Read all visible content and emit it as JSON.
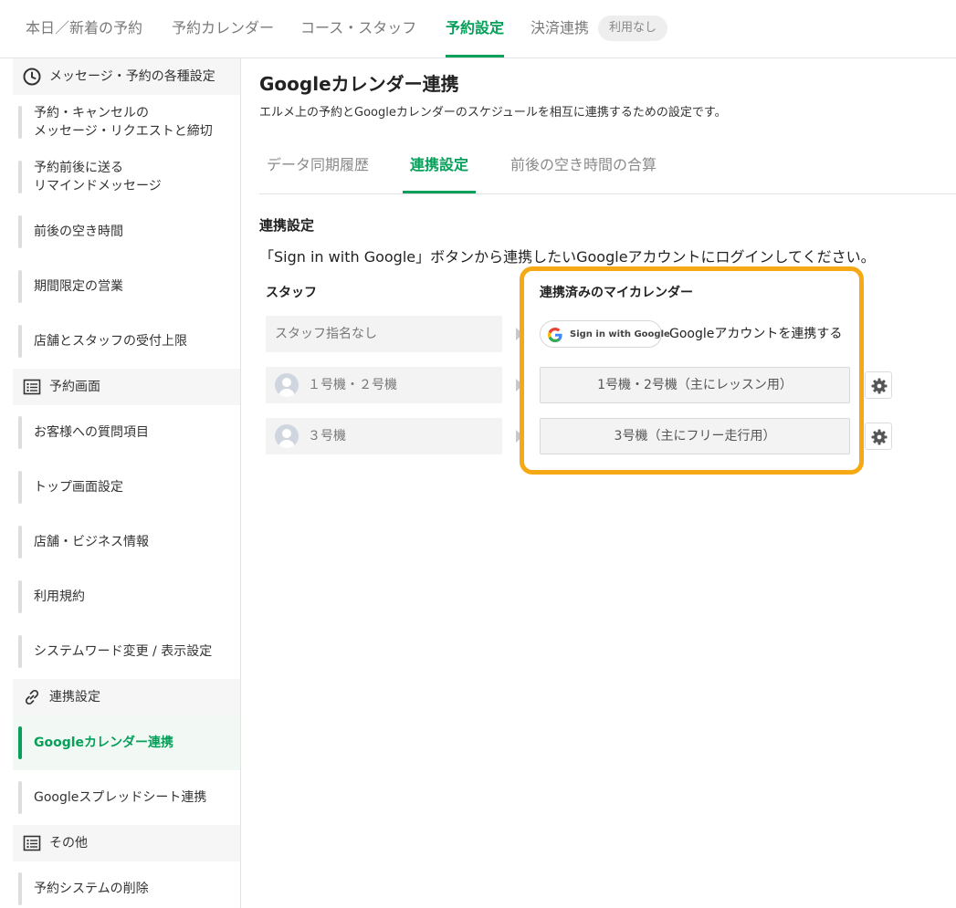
{
  "top_nav": {
    "tabs": [
      {
        "label": "本日／新着の予約"
      },
      {
        "label": "予約カレンダー"
      },
      {
        "label": "コース・スタッフ"
      },
      {
        "label": "予約設定"
      },
      {
        "label": "決済連携"
      }
    ],
    "active_tab": "予約設定",
    "payment_badge": "利用なし"
  },
  "sidebar": {
    "sections": [
      {
        "label": "メッセージ・予約の各種設定",
        "icon": "clock-icon"
      },
      {
        "label": "予約画面",
        "icon": "list-icon"
      },
      {
        "label": "連携設定",
        "icon": "link-icon"
      },
      {
        "label": "その他",
        "icon": "list-icon"
      }
    ],
    "items": [
      {
        "label": "予約・キャンセルの\nメッセージ・リクエストと締切"
      },
      {
        "label": "予約前後に送る\nリマインドメッセージ"
      },
      {
        "label": "前後の空き時間"
      },
      {
        "label": "期間限定の営業"
      },
      {
        "label": "店舗とスタッフの受付上限"
      },
      {
        "label": "お客様への質問項目"
      },
      {
        "label": "トップ画面設定"
      },
      {
        "label": "店舗・ビジネス情報"
      },
      {
        "label": "利用規約"
      },
      {
        "label": "システムワード変更 / 表示設定"
      },
      {
        "label": "Googleカレンダー連携"
      },
      {
        "label": "Googleスプレッドシート連携"
      },
      {
        "label": "予約システムの削除"
      }
    ],
    "active_item": "Googleカレンダー連携"
  },
  "main": {
    "title": "Googleカレンダー連携",
    "description": "エルメ上の予約とGoogleカレンダーのスケジュールを相互に連携するための設定です。",
    "subtabs": [
      {
        "label": "データ同期履歴"
      },
      {
        "label": "連携設定"
      },
      {
        "label": "前後の空き時間の合算"
      }
    ],
    "active_subtab": "連携設定",
    "section_title": "連携設定",
    "section_desc": "「Sign in with Google」ボタンから連携したいGoogleアカウントにログインしてください。",
    "staff_header": "スタッフ",
    "calendar_header": "連携済みのマイカレンダー",
    "rows": [
      {
        "staff": "スタッフ指名なし",
        "has_avatar": false,
        "sign_in_label": "Sign in with Google",
        "connect_text": "Googleアカウントを連携する"
      },
      {
        "staff": "１号機・２号機",
        "has_avatar": true,
        "calendar": "1号機・2号機（主にレッスン用）"
      },
      {
        "staff": "３号機",
        "has_avatar": true,
        "calendar": "3号機（主にフリー走行用）"
      }
    ]
  },
  "colors": {
    "accent_green": "#06a05a",
    "highlight_orange": "#f6a914",
    "sidebar_active_bg": "#f2f9f4"
  }
}
